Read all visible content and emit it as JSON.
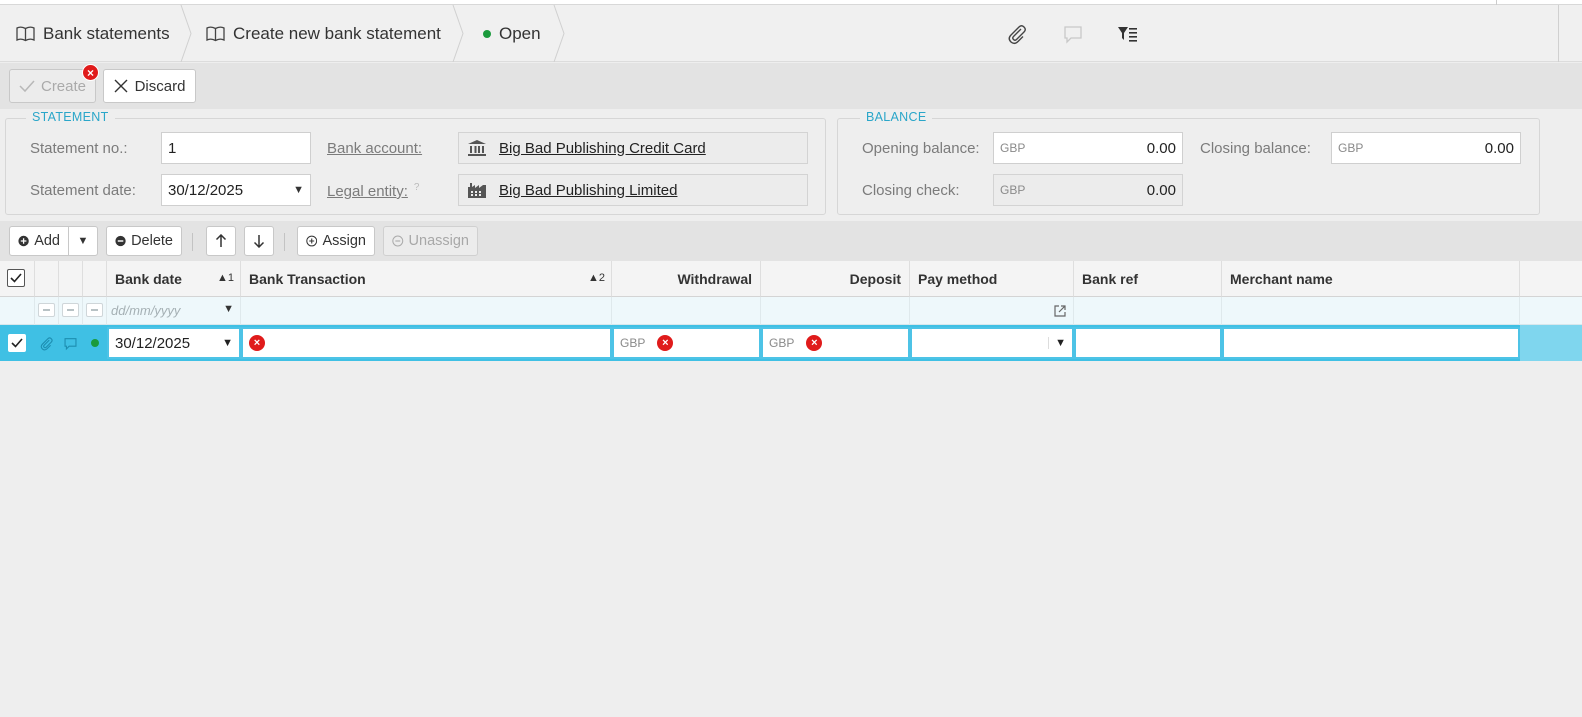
{
  "breadcrumb": {
    "item1": "Bank statements",
    "item2": "Create new bank statement",
    "status": "Open"
  },
  "toolbar": {
    "create_label": "Create",
    "discard_label": "Discard",
    "error_mark": "×"
  },
  "statement": {
    "section_title": "STATEMENT",
    "no_label": "Statement no.:",
    "no_value": "1",
    "date_label": "Statement date:",
    "date_value": "30/12/2025",
    "bank_account_label": "Bank account:",
    "bank_account_value": "Big Bad Publishing Credit Card",
    "legal_entity_label": "Legal entity:",
    "legal_entity_help": "?",
    "legal_entity_value": "Big Bad Publishing Limited"
  },
  "balance": {
    "section_title": "BALANCE",
    "opening_label": "Opening balance:",
    "opening_currency": "GBP",
    "opening_value": "0.00",
    "closing_label": "Closing balance:",
    "closing_currency": "GBP",
    "closing_value": "0.00",
    "check_label": "Closing check:",
    "check_currency": "GBP",
    "check_value": "0.00"
  },
  "grid_toolbar": {
    "add": "Add",
    "delete": "Delete",
    "assign": "Assign",
    "unassign": "Unassign"
  },
  "grid": {
    "columns": {
      "bank_date": "Bank date",
      "bank_date_sort": "▲1",
      "bank_transaction": "Bank Transaction",
      "bank_transaction_sort": "▲2",
      "withdrawal": "Withdrawal",
      "deposit": "Deposit",
      "pay_method": "Pay method",
      "bank_ref": "Bank ref",
      "merchant_name": "Merchant name"
    },
    "filter": {
      "date_placeholder": "dd/mm/yyyy"
    },
    "row": {
      "bank_date": "30/12/2025",
      "withdrawal_currency": "GBP",
      "deposit_currency": "GBP",
      "error_mark": "×"
    }
  },
  "colors": {
    "accent": "#2aa6c9",
    "selected_row": "#3fc0e4",
    "error": "#e01b1b",
    "status_open": "#1a9a3c"
  },
  "icons": [
    "book-icon",
    "paperclip-icon",
    "comment-icon",
    "filter-list-icon",
    "checkmark-icon",
    "close-icon",
    "bank-icon",
    "factory-icon",
    "plus-circle-icon",
    "minus-circle-icon",
    "arrow-up-icon",
    "arrow-down-icon",
    "external-link-icon",
    "error-icon"
  ]
}
